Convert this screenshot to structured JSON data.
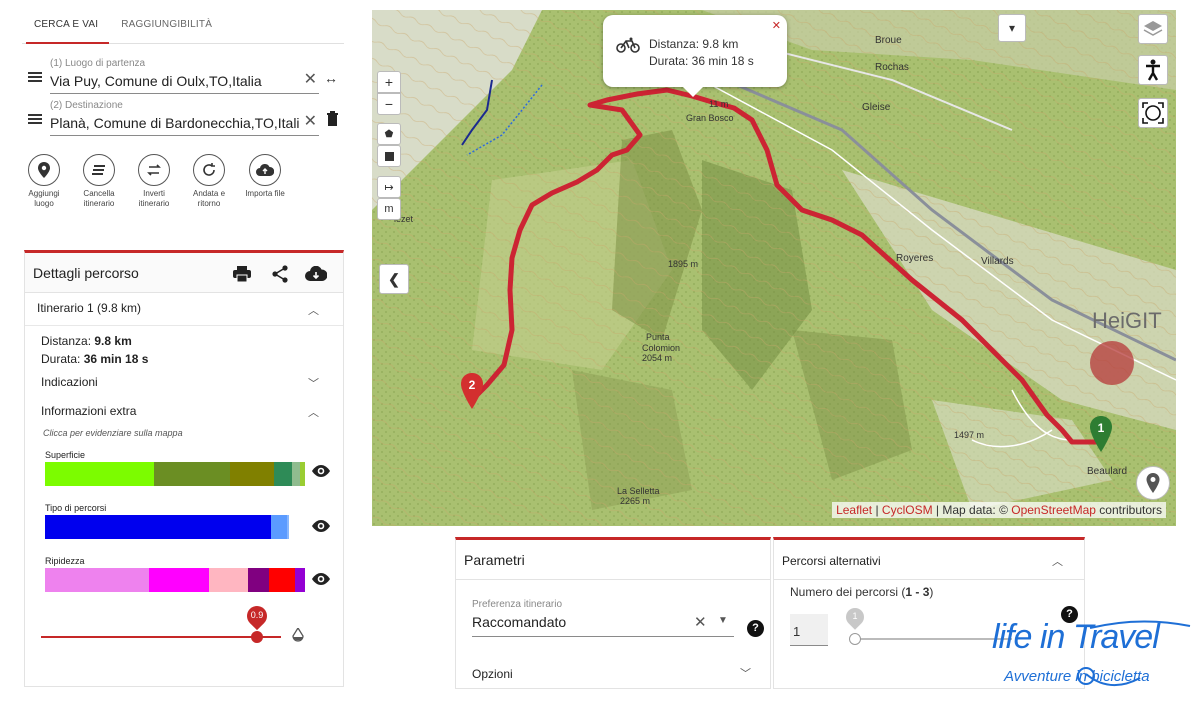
{
  "tabs": [
    {
      "label": "CERCA E VAI",
      "active": true
    },
    {
      "label": "RAGGIUNGIBILITÀ",
      "active": false
    }
  ],
  "start": {
    "label": "(1) Luogo di partenza",
    "value": "Via Puy, Comune di Oulx,TO,Italia"
  },
  "destination": {
    "label": "(2) Destinazione",
    "value": "Planà, Comune di Bardonecchia,TO,Italia"
  },
  "actions": [
    {
      "icon": "location-pin-icon",
      "label_line1": "Aggiungi",
      "label_line2": "luogo"
    },
    {
      "icon": "eraser-icon",
      "label_line1": "Cancella",
      "label_line2": "itinerario"
    },
    {
      "icon": "reverse-icon",
      "label_line1": "Inverti",
      "label_line2": "itinerario"
    },
    {
      "icon": "round-trip-icon",
      "label_line1": "Andata e",
      "label_line2": "ritorno"
    },
    {
      "icon": "cloud-upload-icon",
      "label_line1": "Importa file",
      "label_line2": ""
    }
  ],
  "details": {
    "title": "Dettagli percorso",
    "itinerary": "Itinerario 1 (9.8 km)",
    "distance_label": "Distanza:",
    "distance_value": "9.8 km",
    "duration_label": "Durata:",
    "duration_value": "36 min 18 s",
    "directions_label": "Indicazioni",
    "extra_label": "Informazioni extra",
    "extra_hint": "Clicca per evidenziare sulla mappa",
    "bars": [
      {
        "label": "Superficie",
        "segments": [
          {
            "color": "#7cfc00",
            "share": 0.42
          },
          {
            "color": "#6b8e23",
            "share": 0.29
          },
          {
            "color": "#808000",
            "share": 0.17
          },
          {
            "color": "#2e8b57",
            "share": 0.07
          },
          {
            "color": "#8fbc8f",
            "share": 0.03
          },
          {
            "color": "#9acd32",
            "share": 0.02
          }
        ]
      },
      {
        "label": "Tipo di percorsi",
        "segments": [
          {
            "color": "#0000ee",
            "share": 0.87
          },
          {
            "color": "#5b9bff",
            "share": 0.06
          },
          {
            "color": "#87b7ff",
            "share": 0.01
          }
        ]
      },
      {
        "label": "Ripidezza",
        "segments": [
          {
            "color": "#ee82ee",
            "share": 0.4
          },
          {
            "color": "#ff00ff",
            "share": 0.23
          },
          {
            "color": "#ffb6c1",
            "share": 0.15
          },
          {
            "color": "#800080",
            "share": 0.08
          },
          {
            "color": "#ff0000",
            "share": 0.1
          },
          {
            "color": "#9400d3",
            "share": 0.04
          }
        ]
      }
    ],
    "slider_value": "0.9",
    "slider_fraction": 0.9
  },
  "map": {
    "popup_distance": "Distanza: 9.8 km",
    "popup_duration": "Durata: 36 min 18 s",
    "places": {
      "broue": "Broue",
      "rochas": "Rochas",
      "gleise": "Gleise",
      "royeres": "Royeres",
      "villards": "Villards",
      "beaulard": "Beaulard",
      "gran_bosco": "Gran Bosco",
      "elev_1895": "1895 m",
      "punta": "Punta",
      "colomion": "Colomion",
      "elev_2054": "2054 m",
      "selletta": "La Selletta",
      "elev_2265": "2265 m",
      "elev_1497": "1497 m",
      "lezet": "lezet",
      "elev_11": "11 m"
    },
    "heigit_label": "HeiGIT",
    "marker_start": "1",
    "marker_end": "2",
    "zoom_in": "+",
    "zoom_out": "−",
    "measure_label": "m",
    "attribution": {
      "leaflet": "Leaflet",
      "sep1": " | ",
      "cyclosm": "CyclOSM",
      "sep2": " | Map data: © ",
      "osm": "OpenStreetMap",
      "contrib": " contributors"
    }
  },
  "params": {
    "title": "Parametri",
    "preference_label": "Preferenza itinerario",
    "preference_value": "Raccomandato",
    "options_label": "Opzioni"
  },
  "alternatives": {
    "title": "Percorsi alternativi",
    "count_label": "Numero dei percorsi (",
    "count_range": "1 - 3",
    "count_close": ")",
    "input_value": "1",
    "slider_value": "1"
  },
  "logo": {
    "line1": "life in Travel",
    "line2": "Avventure in bicicletta"
  },
  "colors": {
    "accent": "#c62828",
    "route": "#cc2433",
    "start_marker": "#2e7d32",
    "end_marker": "#d32f2f"
  }
}
